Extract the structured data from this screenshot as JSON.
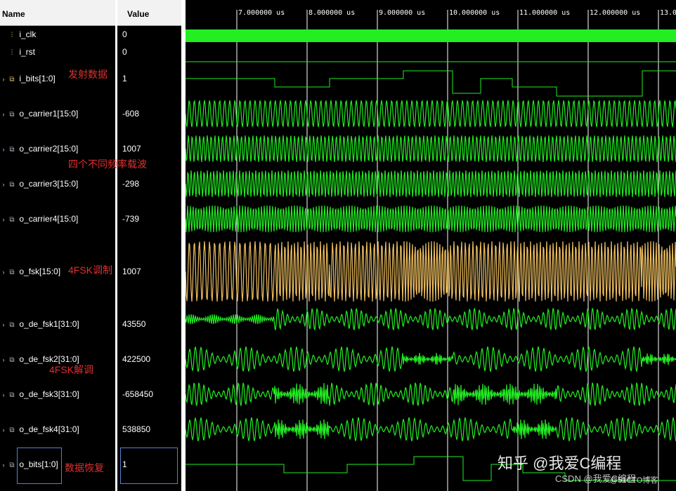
{
  "headers": {
    "name": "Name",
    "value": "Value"
  },
  "signals": [
    {
      "name": "i_clk",
      "value": "0",
      "kind": "bit"
    },
    {
      "name": "i_rst",
      "value": "0",
      "kind": "bit"
    },
    {
      "name": "i_bits[1:0]",
      "value": "1",
      "kind": "bus"
    },
    {
      "name": "o_carrier1[15:0]",
      "value": "-608",
      "kind": "bus"
    },
    {
      "name": "o_carrier2[15:0]",
      "value": "1007",
      "kind": "bus"
    },
    {
      "name": "o_carrier3[15:0]",
      "value": "-298",
      "kind": "bus"
    },
    {
      "name": "o_carrier4[15:0]",
      "value": "-739",
      "kind": "bus"
    },
    {
      "name": "o_fsk[15:0]",
      "value": "1007",
      "kind": "bus"
    },
    {
      "name": "o_de_fsk1[31:0]",
      "value": "43550",
      "kind": "bus"
    },
    {
      "name": "o_de_fsk2[31:0]",
      "value": "422500",
      "kind": "bus"
    },
    {
      "name": "o_de_fsk3[31:0]",
      "value": "-658450",
      "kind": "bus"
    },
    {
      "name": "o_de_fsk4[31:0]",
      "value": "538850",
      "kind": "bus"
    },
    {
      "name": "o_bits[1:0]",
      "value": "1",
      "kind": "bus"
    }
  ],
  "timeline": {
    "ticks": [
      "7.000000 us",
      "8.000000 us",
      "9.000000 us",
      "10.000000 us",
      "11.000000 us",
      "12.000000 us",
      "13.0"
    ]
  },
  "annotations": {
    "send_data": "发射数据",
    "carriers": "四个不同频率载波",
    "modulation": "4FSK调制",
    "demodulation": "4FSK解调",
    "recovery": "数据恢复"
  },
  "watermarks": {
    "zhihu": "知乎 @我爱C编程",
    "csdn": "CSDN @我爱C编程",
    "blog": "@51CTO博客"
  },
  "colors": {
    "wave": "#22ee22",
    "fsk": "#f0c060",
    "marker": "#ffffff",
    "annotation": "#e03030"
  }
}
